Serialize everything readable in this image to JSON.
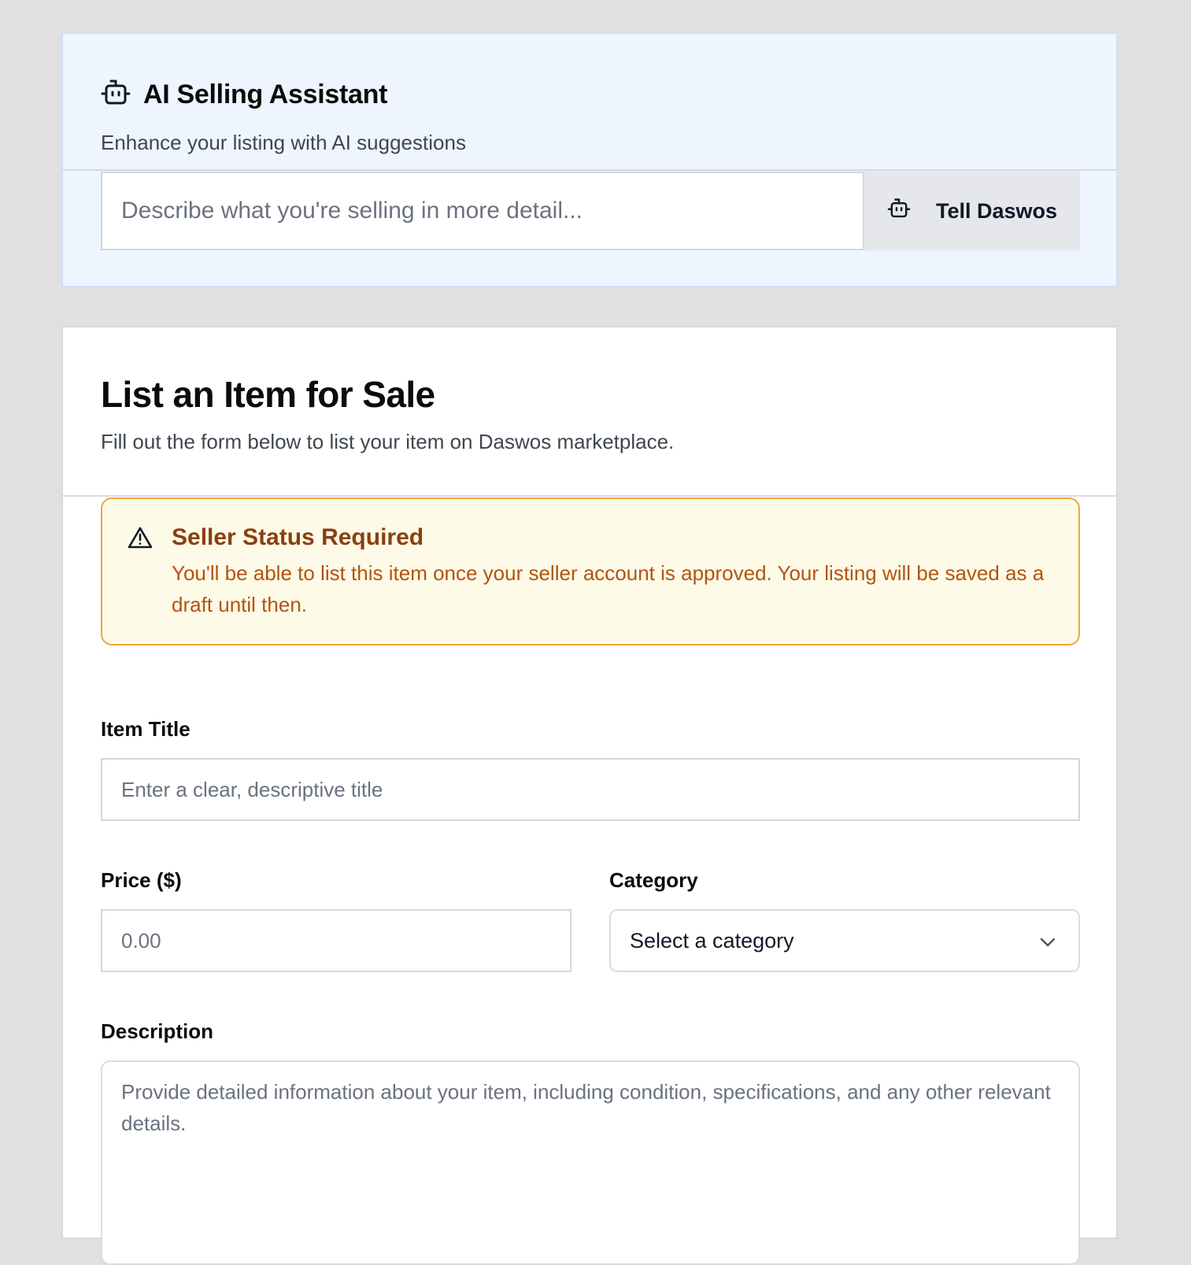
{
  "ai_assistant": {
    "title": "AI Selling Assistant",
    "subtitle": "Enhance your listing with AI suggestions",
    "input_placeholder": "Describe what you're selling in more detail...",
    "button_label": "Tell Daswos",
    "icon": "robot-icon"
  },
  "form": {
    "title": "List an Item for Sale",
    "subtitle": "Fill out the form below to list your item on Daswos marketplace.",
    "alert": {
      "icon": "warning-triangle-icon",
      "title": "Seller Status Required",
      "body": "You'll be able to list this item once your seller account is approved. Your listing will be saved as a draft until then.",
      "border_color": "#eda93a",
      "background_color": "#fefae8"
    },
    "item_title": {
      "label": "Item Title",
      "placeholder": "Enter a clear, descriptive title",
      "value": ""
    },
    "price": {
      "label": "Price ($)",
      "placeholder": "0.00",
      "value": ""
    },
    "category": {
      "label": "Category",
      "selected": "Select a category",
      "icon": "chevron-down-icon"
    },
    "description": {
      "label": "Description",
      "placeholder": "Provide detailed information about your item, including condition, specifications, and any other relevant details.",
      "value": ""
    }
  }
}
